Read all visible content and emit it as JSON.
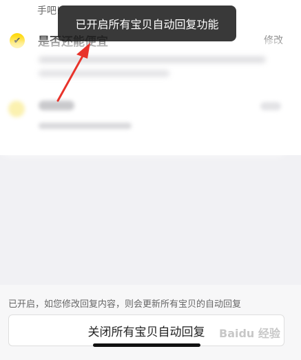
{
  "list": {
    "prev_text": "手吧!",
    "item1": {
      "title": "是否还能便宜",
      "edit": "修改",
      "check_icon": "check-icon"
    }
  },
  "toast": {
    "text": "已开启所有宝贝自动回复功能"
  },
  "footer": {
    "note": "已开启，如您修改回复内容，则会更新所有宝贝的自动回复",
    "close_button": "关闭所有宝贝自动回复"
  },
  "watermark": {
    "text": "Baidu 经验"
  },
  "colors": {
    "accent": "#ffd800",
    "arrow": "#e8332b",
    "toast_bg": "#1e1e1e"
  }
}
